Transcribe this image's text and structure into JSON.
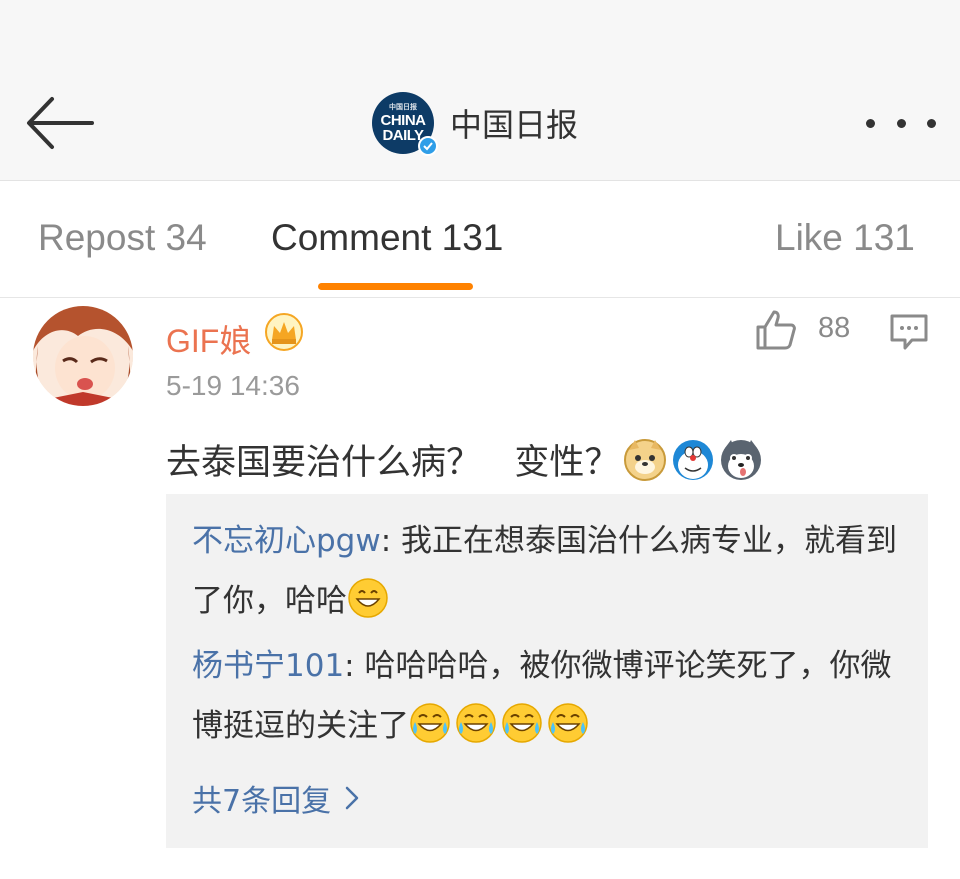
{
  "header": {
    "title": "中国日报",
    "logo_lines": [
      "中国日报",
      "CHINA",
      "DAILY"
    ]
  },
  "tabs": [
    {
      "label": "Repost 34"
    },
    {
      "label": "Comment 131"
    },
    {
      "label": "Like 131"
    }
  ],
  "comment": {
    "username": "GIF娘",
    "timestamp": "5-19 14:36",
    "like_count": "88",
    "text": "去泰国要治什么病？   变性？",
    "replies": [
      {
        "author": "不忘初心pgw",
        "text": ": 我正在想泰国治什么病专业，就看到了你，哈哈"
      },
      {
        "author": "杨书宁101",
        "text": ": 哈哈哈哈，被你微博评论笑死了，你微博挺逗的关注了"
      }
    ],
    "more_replies_label": "共7条回复"
  },
  "colors": {
    "accent": "#ff8200",
    "username": "#eb7350",
    "link": "#4a72a8",
    "verified": "#2f9ee8"
  }
}
